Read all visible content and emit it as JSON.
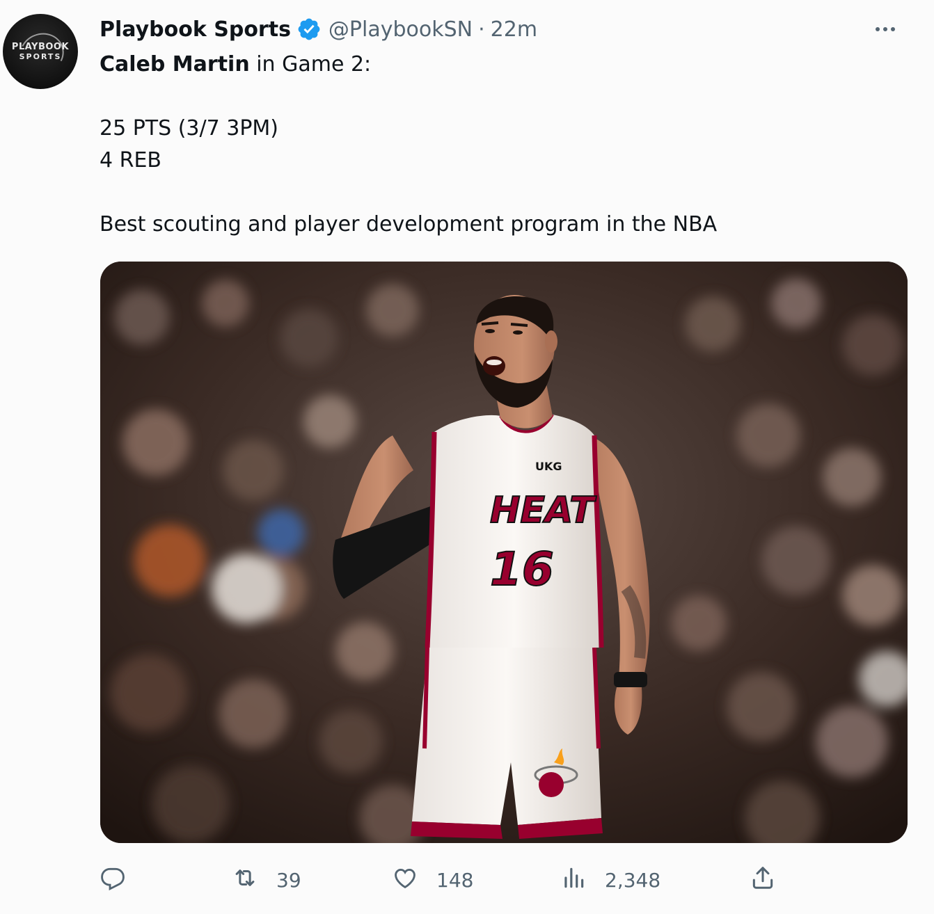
{
  "author": {
    "display_name": "Playbook Sports",
    "handle": "@PlaybookSN",
    "separator": "·",
    "time": "22m",
    "avatar_line1": "PLAYBOOK",
    "avatar_line2": "SPORTS",
    "verified": true
  },
  "tweet": {
    "line1_bold": "Caleb Martin",
    "line1_rest": " in Game 2:",
    "stat1": "25 PTS (3/7 3PM)",
    "stat2": "4 REB",
    "closing": "Best scouting and player development program in the NBA"
  },
  "media": {
    "jersey_sponsor": "UKG",
    "jersey_team": "HEAT",
    "jersey_number": "16"
  },
  "actions": {
    "reply_count": "",
    "retweet_count": "39",
    "like_count": "148",
    "views_count": "2,348"
  },
  "icons": {
    "verified": "verified-badge-icon",
    "more": "more-icon",
    "reply": "reply-icon",
    "retweet": "retweet-icon",
    "like": "like-icon",
    "views": "views-icon",
    "share": "share-icon"
  },
  "colors": {
    "verified_blue": "#1d9bf0",
    "muted": "#536471",
    "text": "#0f1419",
    "heat_red": "#98002e"
  }
}
